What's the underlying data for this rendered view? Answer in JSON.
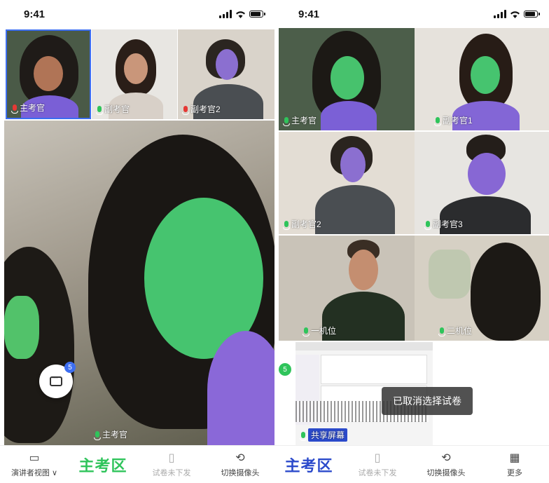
{
  "left": {
    "status": {
      "time": "9:41"
    },
    "thumbs": [
      {
        "label": "主考官"
      },
      {
        "label": "副考官"
      },
      {
        "label": "副考官2"
      }
    ],
    "main_label": "主考官",
    "chat_badge": "5",
    "tabs": {
      "presenter": "演讲者视图 ∨",
      "brand": "主考区",
      "paper": "试卷未下发",
      "camera": "切换摄像头"
    }
  },
  "right": {
    "status": {
      "time": "9:41"
    },
    "grid": [
      {
        "label": "主考官"
      },
      {
        "label": "副考官1"
      },
      {
        "label": "副考官2"
      },
      {
        "label": "副考官3"
      },
      {
        "label": "一机位"
      },
      {
        "label": "二机位"
      }
    ],
    "share_label": "共享屏幕",
    "toast": "已取消选择试卷",
    "count_badge": "5",
    "tabs": {
      "brand": "主考区",
      "paper": "试卷未下发",
      "camera": "切换摄像头",
      "more": "更多"
    }
  },
  "colors": {
    "green": "#2fc45b",
    "blue": "#2b4acb",
    "accent": "#3d6ef0"
  }
}
